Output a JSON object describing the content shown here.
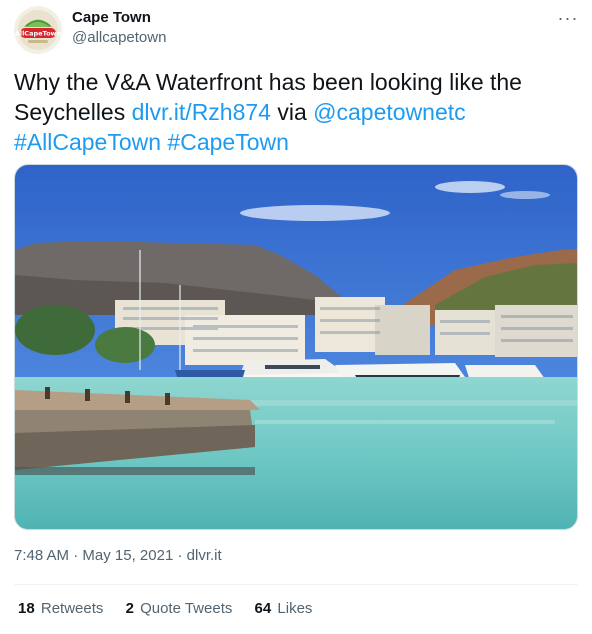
{
  "author": {
    "display_name": "Cape Town",
    "handle": "@allcapetown",
    "avatar_icon": "allcapetown-logo-icon",
    "avatar_text": "AllCapeTown"
  },
  "menu": {
    "icon": "more-horizontal-icon",
    "label": "···"
  },
  "tweet": {
    "text_part1": "Why the V&A Waterfront has been looking like the Seychelles ",
    "link": "dlvr.it/Rzh874",
    "text_part2": " via ",
    "mention": "@capetownetc",
    "hashtag1": "#AllCapeTown",
    "hashtag2": "#CapeTown"
  },
  "media": {
    "icon": "waterfront-photo"
  },
  "meta": {
    "time": "7:48 AM",
    "sep1": " · ",
    "date": "May 15, 2021",
    "sep2": " · ",
    "source": "dlvr.it"
  },
  "stats": {
    "retweets_count": "18",
    "retweets_label": "Retweets",
    "quotes_count": "2",
    "quotes_label": "Quote Tweets",
    "likes_count": "64",
    "likes_label": "Likes"
  },
  "colors": {
    "link": "#1d9bf0",
    "muted": "#536471",
    "text": "#0f1419"
  }
}
